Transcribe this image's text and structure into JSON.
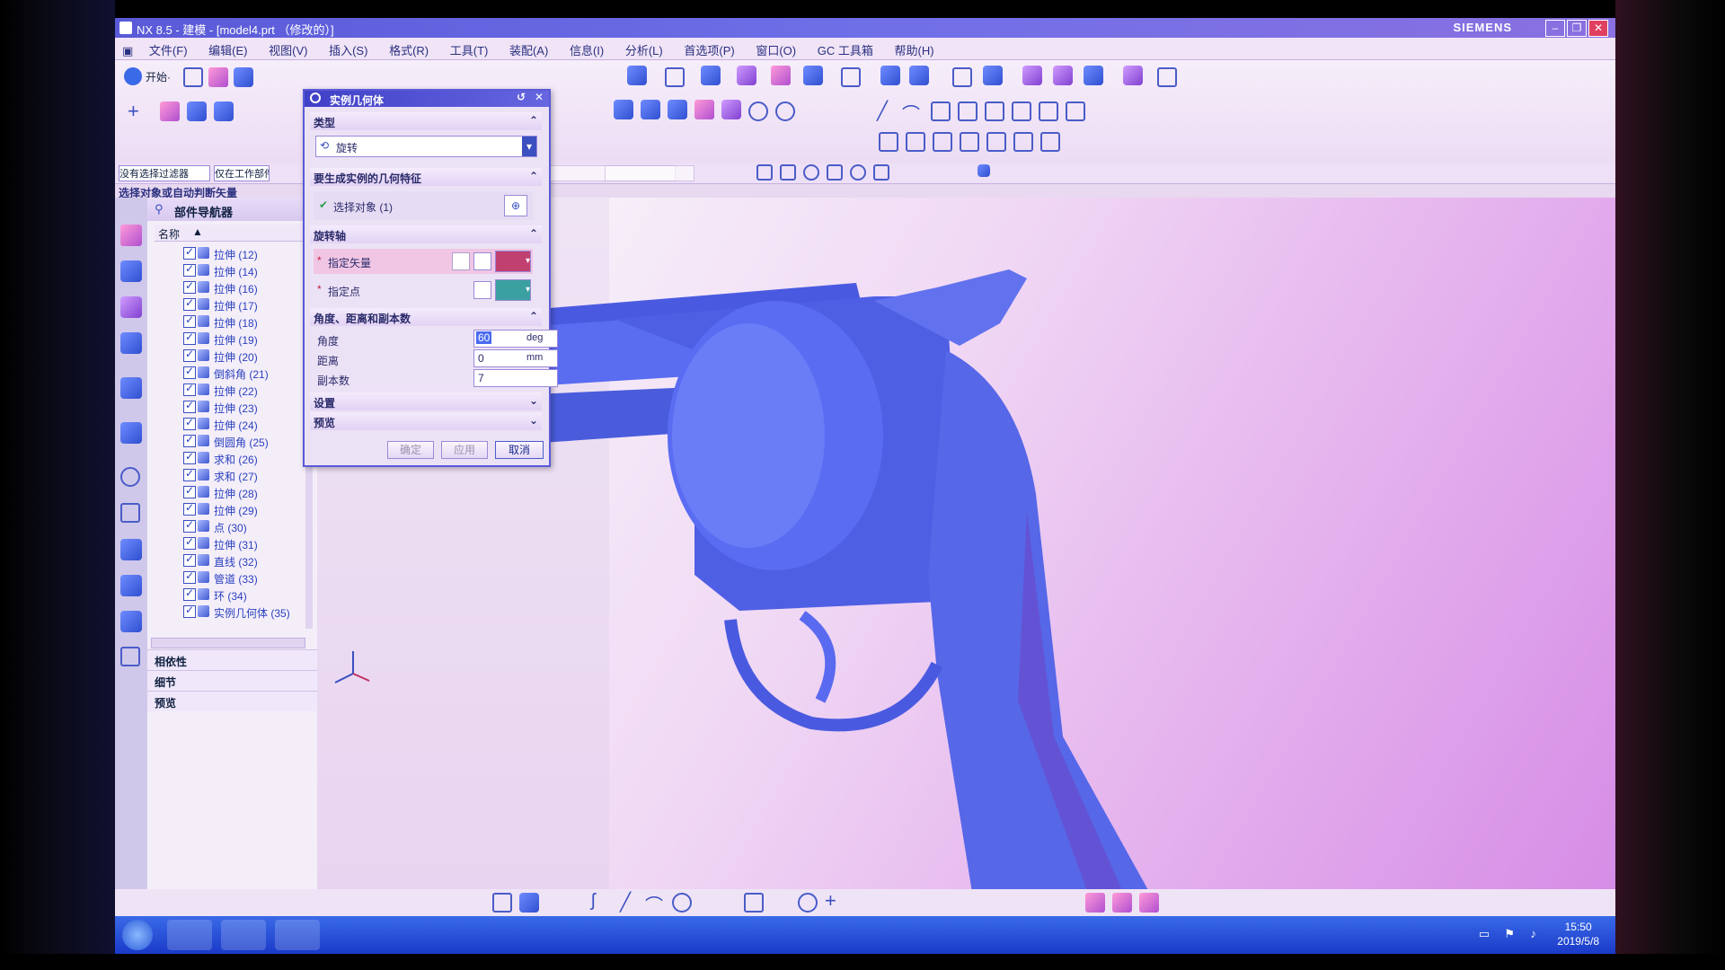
{
  "window": {
    "title": "NX 8.5 - 建模 - [model4.prt （修改的）]",
    "brand": "SIEMENS"
  },
  "menu": [
    "文件(F)",
    "编辑(E)",
    "视图(V)",
    "插入(S)",
    "格式(R)",
    "工具(T)",
    "装配(A)",
    "信息(I)",
    "分析(L)",
    "首选项(P)",
    "窗口(O)",
    "GC 工具箱",
    "帮助(H)"
  ],
  "toolbar": {
    "start_label": "开始·"
  },
  "selection": {
    "filter_label": "没有选择过滤器",
    "scope_label": "仅在工作部件内",
    "hint": "选择对象或自动判断矢量"
  },
  "navigator": {
    "title": "部件导航器",
    "column_name": "名称",
    "items": [
      {
        "label": "拉伸",
        "id": "(12)"
      },
      {
        "label": "拉伸",
        "id": "(14)"
      },
      {
        "label": "拉伸",
        "id": "(16)"
      },
      {
        "label": "拉伸",
        "id": "(17)"
      },
      {
        "label": "拉伸",
        "id": "(18)"
      },
      {
        "label": "拉伸",
        "id": "(19)"
      },
      {
        "label": "拉伸",
        "id": "(20)"
      },
      {
        "label": "倒斜角",
        "id": "(21)"
      },
      {
        "label": "拉伸",
        "id": "(22)"
      },
      {
        "label": "拉伸",
        "id": "(23)"
      },
      {
        "label": "拉伸",
        "id": "(24)"
      },
      {
        "label": "倒圆角",
        "id": "(25)"
      },
      {
        "label": "求和",
        "id": "(26)"
      },
      {
        "label": "求和",
        "id": "(27)"
      },
      {
        "label": "拉伸",
        "id": "(28)"
      },
      {
        "label": "拉伸",
        "id": "(29)"
      },
      {
        "label": "点",
        "id": "(30)"
      },
      {
        "label": "拉伸",
        "id": "(31)"
      },
      {
        "label": "直线",
        "id": "(32)"
      },
      {
        "label": "管道",
        "id": "(33)"
      },
      {
        "label": "环",
        "id": "(34)"
      },
      {
        "label": "实例几何体",
        "id": "(35)"
      }
    ],
    "sections": [
      "相依性",
      "细节",
      "预览"
    ]
  },
  "dialog": {
    "title": "实例几何体",
    "type_section": "类型",
    "type_value": "旋转",
    "objects_section": "要生成实例的几何特征",
    "select_object": "选择对象 (1)",
    "axis_section": "旋转轴",
    "specify_vector": "指定矢量",
    "specify_point": "指定点",
    "angle_section": "角度、距离和副本数",
    "angle_label": "角度",
    "angle_value": "60",
    "angle_unit": "deg",
    "distance_label": "距离",
    "distance_value": "0",
    "distance_unit": "mm",
    "copies_label": "副本数",
    "copies_value": "7",
    "settings_section": "设置",
    "preview_section": "预览",
    "ok_label": "确定",
    "apply_label": "应用",
    "cancel_label": "取消"
  },
  "taskbar": {
    "time": "15:50",
    "date": "2019/5/8"
  }
}
